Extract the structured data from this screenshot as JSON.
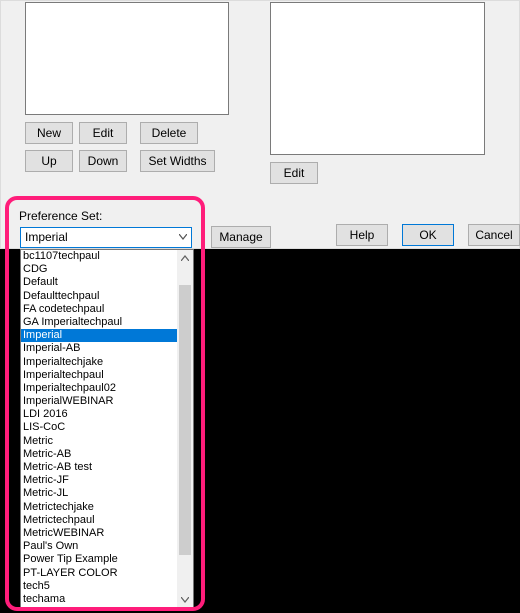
{
  "left_buttons_row1": {
    "new": "New",
    "edit": "Edit",
    "delete": "Delete"
  },
  "left_buttons_row2": {
    "up": "Up",
    "down": "Down",
    "setw": "Set Widths"
  },
  "right_edit": "Edit",
  "manage": "Manage",
  "help": "Help",
  "ok": "OK",
  "cancel": "Cancel",
  "pref_label": "Preference Set:",
  "combo_value": "Imperial",
  "dropdown_selected_index": 6,
  "dropdown_items": [
    "bc1107techpaul",
    "CDG",
    "Default",
    "Defaulttechpaul",
    "FA codetechpaul",
    "GA Imperialtechpaul",
    "Imperial",
    "Imperial-AB",
    "Imperialtechjake",
    "Imperialtechpaul",
    "Imperialtechpaul02",
    "ImperialWEBINAR",
    "LDI 2016",
    "LIS-CoC",
    "Metric",
    "Metric-AB",
    "Metric-AB test",
    "Metric-JF",
    "Metric-JL",
    "Metrictechjake",
    "Metrictechpaul",
    "MetricWEBINAR",
    "Paul's Own",
    "Power Tip Example",
    "PT-LAYER COLOR",
    "tech5",
    "techama"
  ]
}
